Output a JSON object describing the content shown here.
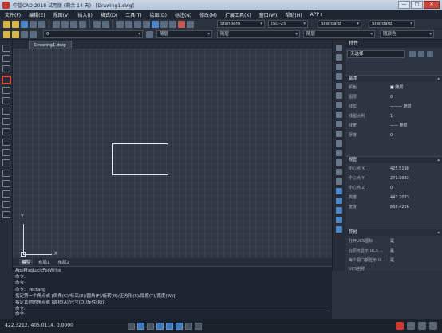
{
  "window": {
    "title": "中望CAD 2018 试用版 (剩余 14 天) - [Drawing1.dwg]",
    "minimize": "—",
    "maximize": "□",
    "close": "✕"
  },
  "menu": [
    "文件(F)",
    "编辑(E)",
    "视图(V)",
    "插入(I)",
    "格式(O)",
    "工具(T)",
    "绘图(D)",
    "标注(N)",
    "修改(M)",
    "扩展工具(X)",
    "窗口(W)",
    "帮助(H)",
    "APP+"
  ],
  "toolbar": {
    "text_style": "Standard",
    "dim_style": "ISO-25",
    "table_style": "Standard",
    "multileader_style": "Standard",
    "layer": "0",
    "color": "随层",
    "linetype": "随层",
    "lineweight": "随层",
    "plotstyle": "随颜色"
  },
  "doc_tab": "Drawing1.dwg",
  "canvas": {
    "ucs_x": "X",
    "ucs_y": "Y"
  },
  "layout_tabs": [
    "模型",
    "布局1",
    "布局2"
  ],
  "properties": {
    "title": "特性",
    "selection": "无选择",
    "sections": {
      "basic": {
        "head": "基本",
        "rows": [
          {
            "k": "颜色",
            "v": "■ 随层"
          },
          {
            "k": "图层",
            "v": "0"
          },
          {
            "k": "线型",
            "v": "——— 随层"
          },
          {
            "k": "线型比例",
            "v": "1"
          },
          {
            "k": "线宽",
            "v": "—— 随层"
          },
          {
            "k": "厚度",
            "v": "0"
          }
        ]
      },
      "view": {
        "head": "视图",
        "rows": [
          {
            "k": "中心点 X",
            "v": "425.5198"
          },
          {
            "k": "中心点 Y",
            "v": "271.9933"
          },
          {
            "k": "中心点 Z",
            "v": "0"
          },
          {
            "k": "高度",
            "v": "447.2073"
          },
          {
            "k": "宽度",
            "v": "868.4256"
          }
        ]
      },
      "misc": {
        "head": "其他",
        "rows": [
          {
            "k": "打开UCS图标",
            "v": "是"
          },
          {
            "k": "在原点显示 UCS …",
            "v": "是"
          },
          {
            "k": "每个视口都显示 U…",
            "v": "是"
          },
          {
            "k": "UCS名称",
            "v": ""
          }
        ]
      }
    }
  },
  "command": {
    "lines": [
      "AppMsgLockForWrite",
      "命令:",
      "命令:",
      "命令: _rectang",
      "指定第一个角点或 [倒角(C)/标高(E)/圆角(F)/旋转(R)/正方形(S)/厚度(T)/宽度(W)]:",
      "指定其他的角点或 [面积(A)/尺寸(D)/旋转(R)]:",
      "命令:"
    ],
    "prompt": "命令:"
  },
  "status": {
    "coords": "422.3212, 405.0114, 0.0000"
  }
}
